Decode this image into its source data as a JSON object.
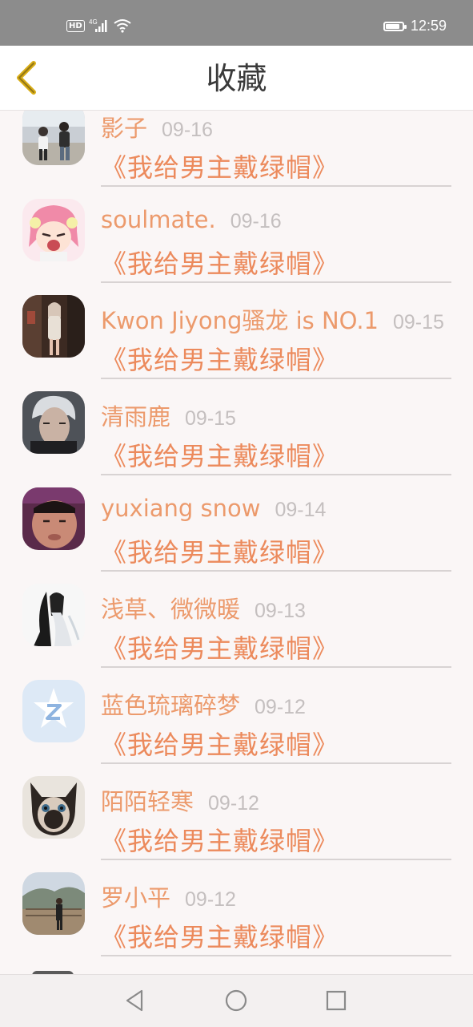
{
  "status_bar": {
    "hd": "HD",
    "network": "4G",
    "time": "12:59",
    "battery_level": 0.85,
    "icons": [
      "hd-icon",
      "signal-icon",
      "wifi-icon",
      "battery-icon"
    ]
  },
  "header": {
    "title": "收藏",
    "back_icon": "chevron-left-icon",
    "accent": "#e6b800"
  },
  "items": [
    {
      "name": "影子",
      "date": "09-16",
      "book": "《我给男主戴绿帽》",
      "avatar": "photo-couple"
    },
    {
      "name": "soulmate.",
      "date": "09-16",
      "book": "《我给男主戴绿帽》",
      "avatar": "anime-girl"
    },
    {
      "name": "Kwon Jiyong骚龙 is NO.1",
      "date": "09-15",
      "book": "《我给男主戴绿帽》",
      "avatar": "photo-woman"
    },
    {
      "name": "清雨鹿",
      "date": "09-15",
      "book": "《我给男主戴绿帽》",
      "avatar": "photo-silver-hair"
    },
    {
      "name": "yuxiang snow",
      "date": "09-14",
      "book": "《我给男主戴绿帽》",
      "avatar": "photo-face"
    },
    {
      "name": "浅草、微微暖",
      "date": "09-13",
      "book": "《我给男主戴绿帽》",
      "avatar": "ink-painting"
    },
    {
      "name": "蓝色琉璃碎梦",
      "date": "09-12",
      "book": "《我给男主戴绿帽》",
      "avatar": "qq-default"
    },
    {
      "name": "陌陌轻寒",
      "date": "09-12",
      "book": "《我给男主戴绿帽》",
      "avatar": "photo-cat"
    },
    {
      "name": "罗小平",
      "date": "09-12",
      "book": "《我给男主戴绿帽》",
      "avatar": "photo-landscape"
    }
  ],
  "nav": {
    "back_icon": "triangle-back-icon",
    "home_icon": "circle-home-icon",
    "recents_icon": "square-recents-icon"
  },
  "colors": {
    "name": "#ec9a6c",
    "book": "#ec8a5c",
    "date": "#c4bfbf",
    "background": "#faf6f6"
  }
}
